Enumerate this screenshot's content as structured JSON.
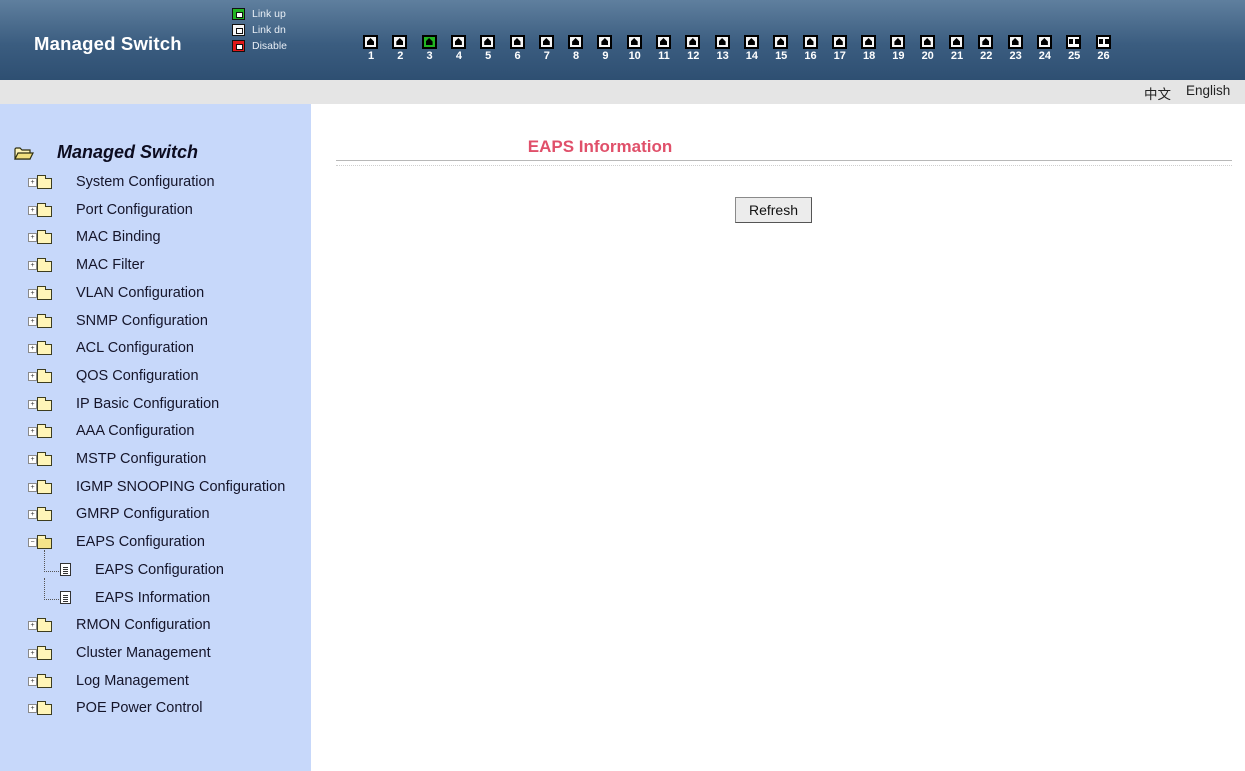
{
  "header": {
    "title": "Managed Switch",
    "legend": [
      {
        "label": "Link up",
        "color": "#22b422"
      },
      {
        "label": "Link dn",
        "color": "#f6f6f6"
      },
      {
        "label": "Disable",
        "color": "#e01818"
      }
    ],
    "ports": [
      {
        "num": "1",
        "state": "dn"
      },
      {
        "num": "2",
        "state": "dn"
      },
      {
        "num": "3",
        "state": "up"
      },
      {
        "num": "4",
        "state": "dn"
      },
      {
        "num": "5",
        "state": "dn"
      },
      {
        "num": "6",
        "state": "dn"
      },
      {
        "num": "7",
        "state": "dn"
      },
      {
        "num": "8",
        "state": "dn"
      },
      {
        "num": "9",
        "state": "dn"
      },
      {
        "num": "10",
        "state": "dn"
      },
      {
        "num": "11",
        "state": "dn"
      },
      {
        "num": "12",
        "state": "dn"
      },
      {
        "num": "13",
        "state": "dn"
      },
      {
        "num": "14",
        "state": "dn"
      },
      {
        "num": "15",
        "state": "dn"
      },
      {
        "num": "16",
        "state": "dn"
      },
      {
        "num": "17",
        "state": "dn"
      },
      {
        "num": "18",
        "state": "dn"
      },
      {
        "num": "19",
        "state": "dn"
      },
      {
        "num": "20",
        "state": "dn"
      },
      {
        "num": "21",
        "state": "dn"
      },
      {
        "num": "22",
        "state": "dn"
      },
      {
        "num": "23",
        "state": "dn"
      },
      {
        "num": "24",
        "state": "dn"
      },
      {
        "num": "25",
        "state": "sfp"
      },
      {
        "num": "26",
        "state": "sfp"
      }
    ]
  },
  "langbar": {
    "chinese": "中文",
    "english": "English"
  },
  "sidebar": {
    "root_label": "Managed Switch",
    "items": [
      {
        "label": "System Configuration"
      },
      {
        "label": "Port Configuration"
      },
      {
        "label": "MAC Binding"
      },
      {
        "label": "MAC Filter"
      },
      {
        "label": "VLAN Configuration"
      },
      {
        "label": "SNMP Configuration"
      },
      {
        "label": "ACL Configuration"
      },
      {
        "label": "QOS Configuration"
      },
      {
        "label": "IP Basic Configuration"
      },
      {
        "label": "AAA Configuration"
      },
      {
        "label": "MSTP Configuration"
      },
      {
        "label": "IGMP SNOOPING Configuration"
      },
      {
        "label": "GMRP Configuration"
      },
      {
        "label": "EAPS Configuration",
        "expanded": true,
        "children": [
          {
            "label": "EAPS Configuration"
          },
          {
            "label": "EAPS Information"
          }
        ]
      },
      {
        "label": "RMON Configuration"
      },
      {
        "label": "Cluster Management"
      },
      {
        "label": "Log Management"
      },
      {
        "label": "POE Power Control"
      }
    ]
  },
  "main": {
    "title": "EAPS Information",
    "refresh_label": "Refresh"
  },
  "colors": {
    "header": "#3b5d80",
    "sidebar": "#c7d8fa",
    "title": "#e0506a",
    "link_up": "#22b422"
  }
}
